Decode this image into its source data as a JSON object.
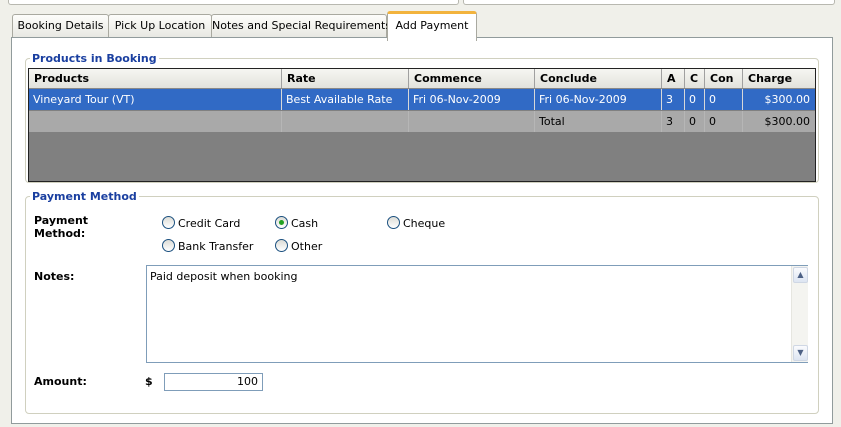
{
  "tabs": [
    {
      "label": "Booking Details"
    },
    {
      "label": "Pick Up Location"
    },
    {
      "label": "Notes and Special Requirements"
    },
    {
      "label": "Add Payment"
    }
  ],
  "products_section": {
    "title": "Products in Booking",
    "columns": [
      "Products",
      "Rate",
      "Commence",
      "Conclude",
      "A",
      "C",
      "Con",
      "Charge"
    ],
    "rows": [
      {
        "product": "Vineyard Tour (VT)",
        "rate": "Best Available Rate",
        "commence": "Fri 06-Nov-2009",
        "conclude": "Fri 06-Nov-2009",
        "a": "3",
        "c": "0",
        "con": "0",
        "charge": "$300.00"
      }
    ],
    "total": {
      "label": "Total",
      "a": "3",
      "c": "0",
      "con": "0",
      "charge": "$300.00"
    }
  },
  "payment_section": {
    "title": "Payment Method",
    "method_label": "Payment Method:",
    "options": [
      {
        "label": "Credit Card",
        "checked": false
      },
      {
        "label": "Cash",
        "checked": true
      },
      {
        "label": "Cheque",
        "checked": false
      },
      {
        "label": "Bank Transfer",
        "checked": false
      },
      {
        "label": "Other",
        "checked": false
      }
    ],
    "notes_label": "Notes:",
    "notes_value": "Paid deposit when booking",
    "amount_label": "Amount:",
    "currency_symbol": "$",
    "amount_value": "100"
  },
  "colors": {
    "accent_tab": "#f2b33d",
    "selected_row": "#316ac5",
    "section_title": "#1a3fa0"
  }
}
